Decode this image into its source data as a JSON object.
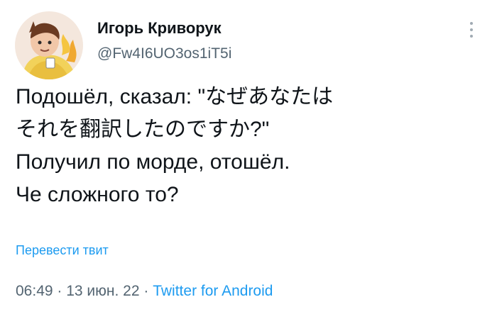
{
  "user": {
    "name": "Игорь Криворук",
    "handle": "@Fw4I6UO3os1iT5i"
  },
  "tweet": {
    "lines": [
      "Подошёл, сказал: \"なぜあなたは",
      "それを翻訳したのですか?\"",
      "Получил по морде, отошёл.",
      "Че сложного то?"
    ],
    "translate_label": "Перевести твит"
  },
  "meta": {
    "time": "06:49",
    "separator": "·",
    "date": "13 июн. 22",
    "source": "Twitter for Android"
  },
  "icons": {
    "more": "more-vertical-icon",
    "avatar": "avatar-image"
  },
  "colors": {
    "text": "#0f1419",
    "secondary": "#536471",
    "link": "#1d9bf0",
    "background": "#ffffff"
  }
}
